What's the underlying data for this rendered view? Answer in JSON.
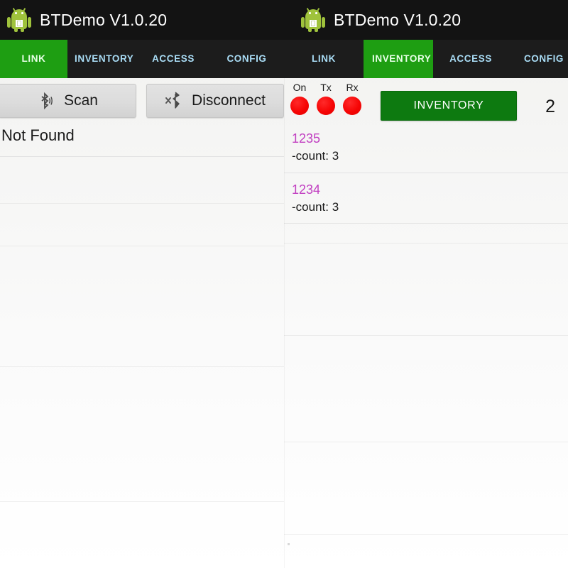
{
  "app": {
    "title": "BTDemo V1.0.20",
    "icon": "android-robot-icon",
    "accent_green": "#1e9e12",
    "button_green": "#0d7a10",
    "tab_text_color": "#a9dcf5",
    "tag_color": "#c13fc1",
    "led_color": "#f60505",
    "titlebar_color": "#131313"
  },
  "left_panel": {
    "title": "BTDemo V1.0.20",
    "tabs": [
      {
        "label": "LINK",
        "active": true
      },
      {
        "label": "INVENTORY",
        "active": false
      },
      {
        "label": "ACCESS",
        "active": false
      },
      {
        "label": "CONFIG",
        "active": false
      }
    ],
    "buttons": {
      "scan": {
        "label": "Scan",
        "icon": "bluetooth-icon"
      },
      "disconnect": {
        "label": "Disconnect",
        "icon": "bluetooth-disconnect-icon"
      }
    },
    "list": {
      "items": [
        {
          "text": "Not Found"
        }
      ]
    }
  },
  "right_panel": {
    "title": "BTDemo V1.0.20",
    "tabs": [
      {
        "label": "LINK",
        "active": false
      },
      {
        "label": "INVENTORY",
        "active": true
      },
      {
        "label": "ACCESS",
        "active": false
      },
      {
        "label": "CONFIG",
        "active": false
      }
    ],
    "leds": [
      {
        "label": "On",
        "state": "red"
      },
      {
        "label": "Tx",
        "state": "red"
      },
      {
        "label": "Rx",
        "state": "red"
      }
    ],
    "inventory_button": {
      "label": "INVENTORY"
    },
    "tag_counter": "2",
    "tags": [
      {
        "id": "1235",
        "count": "-count: 3"
      },
      {
        "id": "1234",
        "count": "-count: 3"
      }
    ]
  }
}
